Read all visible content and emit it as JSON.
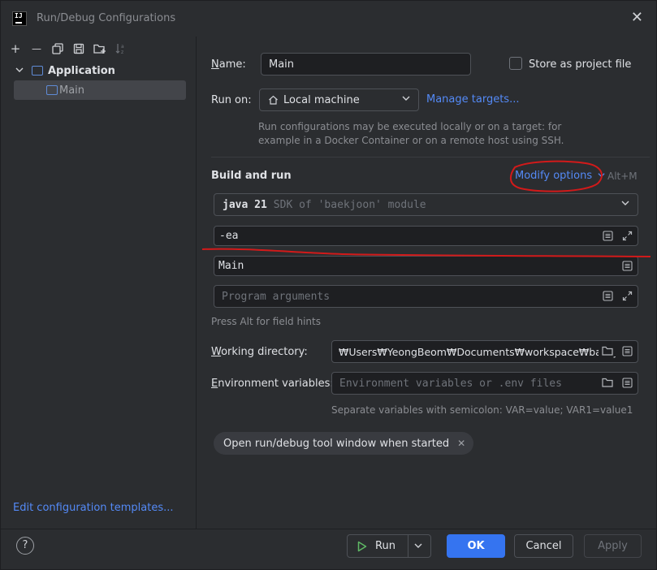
{
  "window": {
    "title": "Run/Debug Configurations",
    "logo": "IJ"
  },
  "toolbar": {
    "add": "+",
    "remove": "—",
    "copy": "⧉",
    "save": "💾",
    "folder": "⊞",
    "sort": "↓a z"
  },
  "tree": {
    "group_label": "Application",
    "item_label": "Main"
  },
  "left_footer": {
    "edit_templates": "Edit configuration templates..."
  },
  "form": {
    "name_label": "Name:",
    "name_value": "Main",
    "store_label": "Store as project file",
    "run_on_label": "Run on:",
    "run_on_value": "Local machine",
    "manage_targets": "Manage targets...",
    "run_on_hint_1": "Run configurations may be executed locally or on a target: for",
    "run_on_hint_2": "example in a Docker Container or on a remote host using SSH.",
    "build_run_title": "Build and run",
    "modify_options": "Modify options",
    "modify_shortcut": "Alt+M",
    "jdk_value": "java 21",
    "jdk_hint": "SDK of 'baekjoon' module",
    "vm_options_value": "-ea",
    "main_class_value": "Main",
    "program_args_placeholder": "Program arguments",
    "field_hints": "Press Alt for field hints",
    "working_dir_label": "Working directory:",
    "working_dir_value": "₩Users₩YeongBeom₩Documents₩workspace₩baekj",
    "env_label": "Environment variables:",
    "env_placeholder": "Environment variables or .env files",
    "env_hint": "Separate variables with semicolon: VAR=value; VAR1=value1",
    "chip_label": "Open run/debug tool window when started",
    "chip_close": "✕"
  },
  "bottom": {
    "help": "?",
    "run_label": "Run",
    "ok_label": "OK",
    "cancel_label": "Cancel",
    "apply_label": "Apply"
  },
  "colors": {
    "background": "#2b2d30",
    "input_bg": "#1e1f22",
    "accent": "#3574f0",
    "link": "#548af7",
    "annotation": "#d21a1a"
  }
}
